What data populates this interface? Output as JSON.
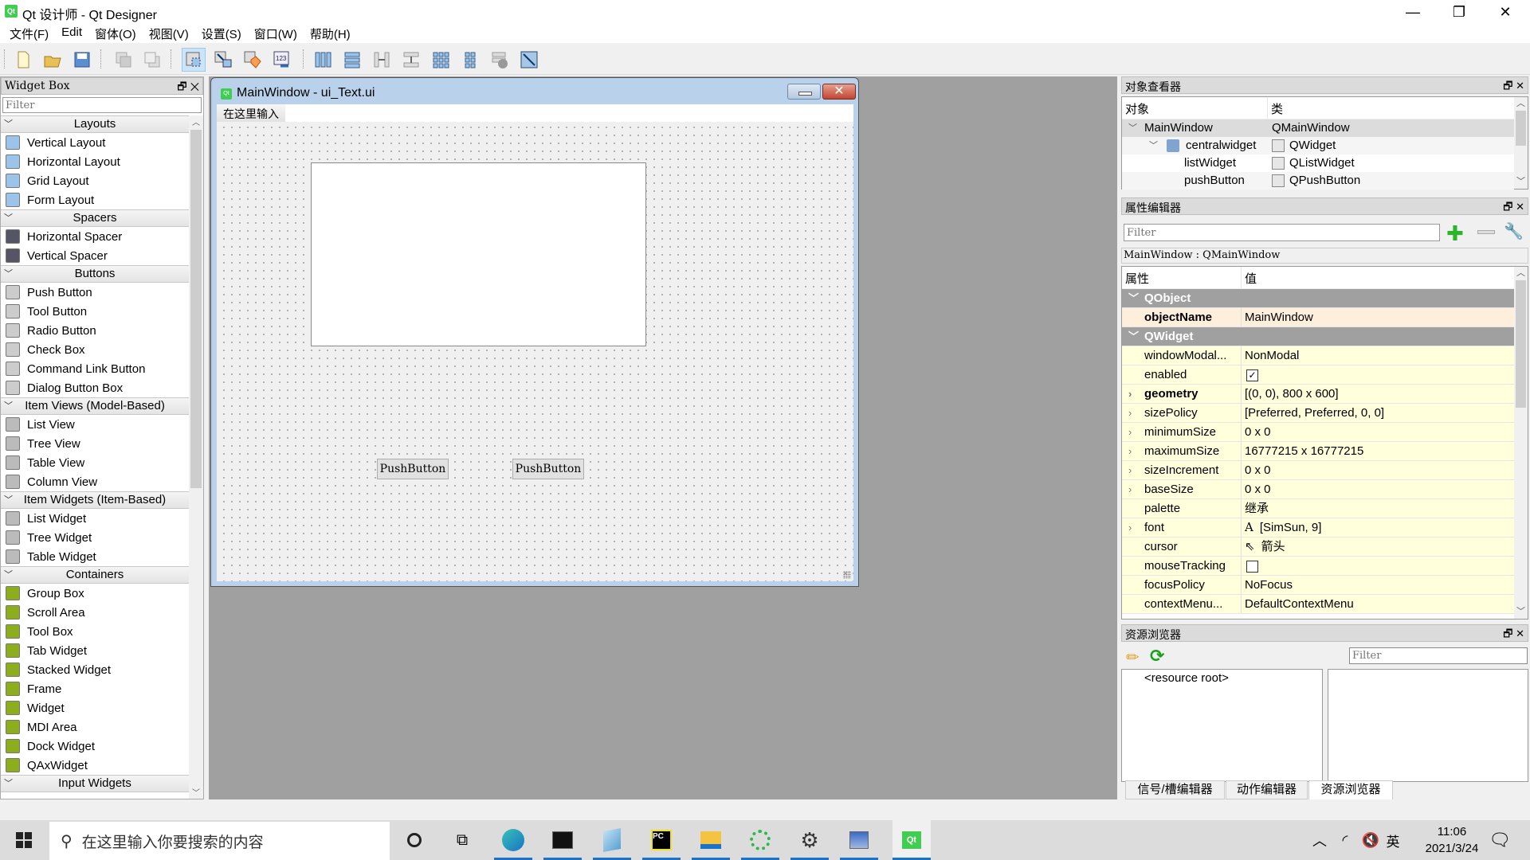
{
  "window": {
    "title": "Qt 设计师 - Qt Designer",
    "app_icon": "qt-logo-icon",
    "controls": {
      "minimize": "—",
      "restore": "❐",
      "close": "✕"
    }
  },
  "menubar": {
    "items": [
      "文件(F)",
      "Edit",
      "窗体(O)",
      "视图(V)",
      "设置(S)",
      "窗口(W)",
      "帮助(H)"
    ]
  },
  "toolbar": {
    "buttons": [
      {
        "icon": "new-file-icon"
      },
      {
        "icon": "open-folder-icon"
      },
      {
        "icon": "save-icon"
      },
      {
        "icon": "send-to-back-icon"
      },
      {
        "icon": "bring-to-front-icon"
      },
      {
        "icon": "edit-widgets-icon",
        "active": true
      },
      {
        "icon": "edit-signals-slots-icon"
      },
      {
        "icon": "edit-buddies-icon"
      },
      {
        "icon": "edit-tab-order-icon"
      },
      {
        "icon": "layout-horizontal-icon"
      },
      {
        "icon": "layout-vertical-icon"
      },
      {
        "icon": "layout-h-splitter-icon"
      },
      {
        "icon": "layout-v-splitter-icon"
      },
      {
        "icon": "layout-grid-icon"
      },
      {
        "icon": "layout-form-icon"
      },
      {
        "icon": "break-layout-icon"
      },
      {
        "icon": "adjust-size-icon"
      }
    ]
  },
  "widget_box": {
    "title": "Widget Box",
    "filter_placeholder": "Filter",
    "categories": [
      {
        "name": "Layouts",
        "items": [
          "Vertical Layout",
          "Horizontal Layout",
          "Grid Layout",
          "Form Layout"
        ]
      },
      {
        "name": "Spacers",
        "items": [
          "Horizontal Spacer",
          "Vertical Spacer"
        ]
      },
      {
        "name": "Buttons",
        "items": [
          "Push Button",
          "Tool Button",
          "Radio Button",
          "Check Box",
          "Command Link Button",
          "Dialog Button Box"
        ]
      },
      {
        "name": "Item Views (Model-Based)",
        "items": [
          "List View",
          "Tree View",
          "Table View",
          "Column View"
        ]
      },
      {
        "name": "Item Widgets (Item-Based)",
        "items": [
          "List Widget",
          "Tree Widget",
          "Table Widget"
        ]
      },
      {
        "name": "Containers",
        "items": [
          "Group Box",
          "Scroll Area",
          "Tool Box",
          "Tab Widget",
          "Stacked Widget",
          "Frame",
          "Widget",
          "MDI Area",
          "Dock Widget",
          "QAxWidget"
        ]
      },
      {
        "name": "Input Widgets",
        "items": []
      }
    ]
  },
  "form": {
    "title": "MainWindow - ui_Text.ui",
    "menu_placeholder": "在这里输入",
    "push_buttons": [
      "PushButton",
      "PushButton"
    ]
  },
  "object_inspector": {
    "title": "对象查看器",
    "columns": [
      "对象",
      "类"
    ],
    "rows": [
      {
        "object": "MainWindow",
        "class": "QMainWindow",
        "level": 0,
        "expanded": true
      },
      {
        "object": "centralwidget",
        "class": "QWidget",
        "level": 1,
        "expanded": true
      },
      {
        "object": "listWidget",
        "class": "QListWidget",
        "level": 2
      },
      {
        "object": "pushButton",
        "class": "QPushButton",
        "level": 2
      }
    ]
  },
  "property_editor": {
    "title": "属性编辑器",
    "filter_placeholder": "Filter",
    "context": "MainWindow : QMainWindow",
    "columns": [
      "属性",
      "值"
    ],
    "groups": [
      {
        "name": "QObject",
        "props": [
          {
            "name": "objectName",
            "value": "MainWindow",
            "bold": true
          }
        ]
      },
      {
        "name": "QWidget",
        "props": [
          {
            "name": "windowModal...",
            "value": "NonModal"
          },
          {
            "name": "enabled",
            "value": "",
            "checkbox": true,
            "checked": true
          },
          {
            "name": "geometry",
            "value": "[(0, 0), 800 x 600]",
            "bold": true,
            "expandable": true
          },
          {
            "name": "sizePolicy",
            "value": "[Preferred, Preferred, 0, 0]",
            "expandable": true
          },
          {
            "name": "minimumSize",
            "value": "0 x 0",
            "expandable": true
          },
          {
            "name": "maximumSize",
            "value": "16777215 x 16777215",
            "expandable": true
          },
          {
            "name": "sizeIncrement",
            "value": "0 x 0",
            "expandable": true
          },
          {
            "name": "baseSize",
            "value": "0 x 0",
            "expandable": true
          },
          {
            "name": "palette",
            "value": "继承"
          },
          {
            "name": "font",
            "value": "[SimSun, 9]",
            "expandable": true,
            "icon": "A"
          },
          {
            "name": "cursor",
            "value": "箭头",
            "icon": "cursor-arrow"
          },
          {
            "name": "mouseTracking",
            "value": "",
            "checkbox": true,
            "checked": false
          },
          {
            "name": "focusPolicy",
            "value": "NoFocus"
          },
          {
            "name": "contextMenu...",
            "value": "DefaultContextMenu"
          }
        ]
      }
    ]
  },
  "resource_browser": {
    "title": "资源浏览器",
    "filter_placeholder": "Filter",
    "root": "<resource root>"
  },
  "bottom_tabs": [
    "信号/槽编辑器",
    "动作编辑器",
    "资源浏览器"
  ],
  "bottom_tabs_selected": 2,
  "taskbar": {
    "search_placeholder": "在这里输入你要搜索的内容",
    "apps": [
      "cortana-icon",
      "task-view-icon",
      "edge-icon",
      "terminal-icon",
      "notepad-icon",
      "pycharm-icon",
      "file-explorer-icon",
      "app-ring-icon",
      "settings-icon",
      "remote-desktop-icon",
      "qt-designer-icon"
    ],
    "ime": "英",
    "time": "11:06",
    "date": "2021/3/24"
  }
}
